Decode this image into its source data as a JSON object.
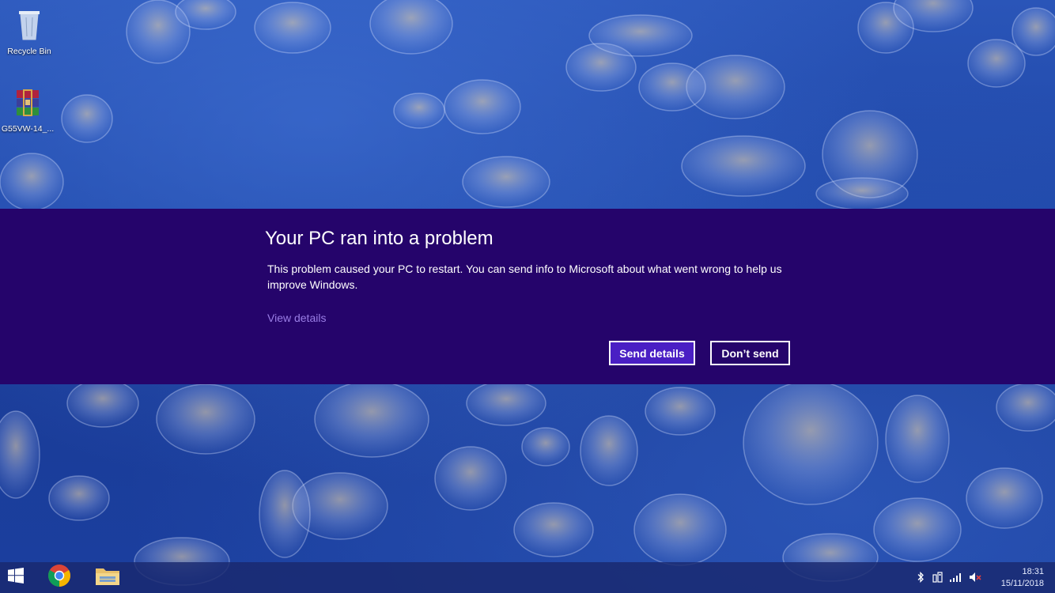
{
  "desktop": {
    "icons": [
      {
        "label": "Recycle Bin",
        "icon": "recycle-bin-icon"
      },
      {
        "label": "G55VW-14_...",
        "icon": "winrar-archive-icon"
      }
    ]
  },
  "dialog": {
    "title": "Your PC ran into a problem",
    "message": "This problem caused your PC to restart. You can send info to Microsoft about what went wrong to help us improve Windows.",
    "view_details": "View details",
    "send_label": "Send details",
    "dont_send_label": "Don’t send",
    "colors": {
      "background": "#25046b",
      "primary_button": "#4a1fc4",
      "link": "#9a7ee6"
    }
  },
  "taskbar": {
    "pinned": [
      {
        "name": "start",
        "icon": "windows-logo-icon"
      },
      {
        "name": "chrome",
        "icon": "chrome-icon"
      },
      {
        "name": "file-explorer",
        "icon": "folder-icon"
      }
    ],
    "tray": {
      "icons": [
        "bluetooth-icon",
        "network-adapter-icon",
        "signal-icon",
        "volume-muted-icon"
      ],
      "time": "18:31",
      "date": "15/11/2018"
    }
  }
}
